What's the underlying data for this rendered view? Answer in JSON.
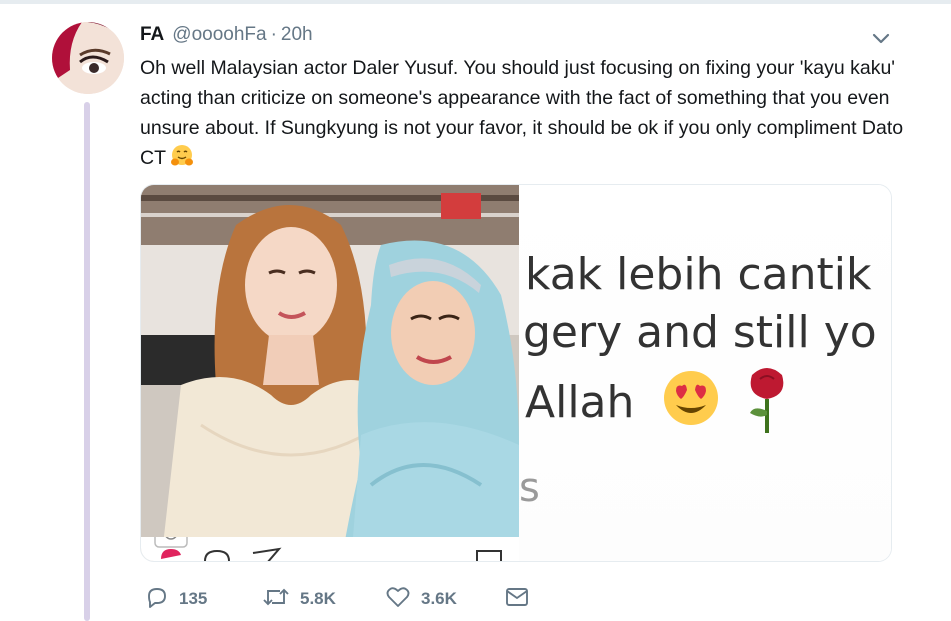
{
  "tweet": {
    "display_name": "FA",
    "handle": "@oooohFa",
    "separator": "·",
    "time": "20h",
    "text": "Oh well Malaysian actor Daler Yusuf. You should just focusing on fixing your 'kayu kaku' acting than criticize on someone's appearance with the fact of something that you even unsure about. If Sungkyung is not your favor, it should be ok if you only compliment Dato CT"
  },
  "media": {
    "right_image_lines": [
      "kak lebih cantik",
      "gery and still yo",
      "Allah",
      "s"
    ]
  },
  "actions": {
    "reply_count": "135",
    "retweet_count": "5.8K",
    "like_count": "3.6K"
  },
  "icons": {
    "reply": "reply-icon",
    "retweet": "retweet-icon",
    "like": "heart-icon",
    "dm": "envelope-icon",
    "more": "chevron-down-icon"
  },
  "colors": {
    "text": "#14171a",
    "secondary": "#657786",
    "thread_line": "#d8d0e8"
  }
}
